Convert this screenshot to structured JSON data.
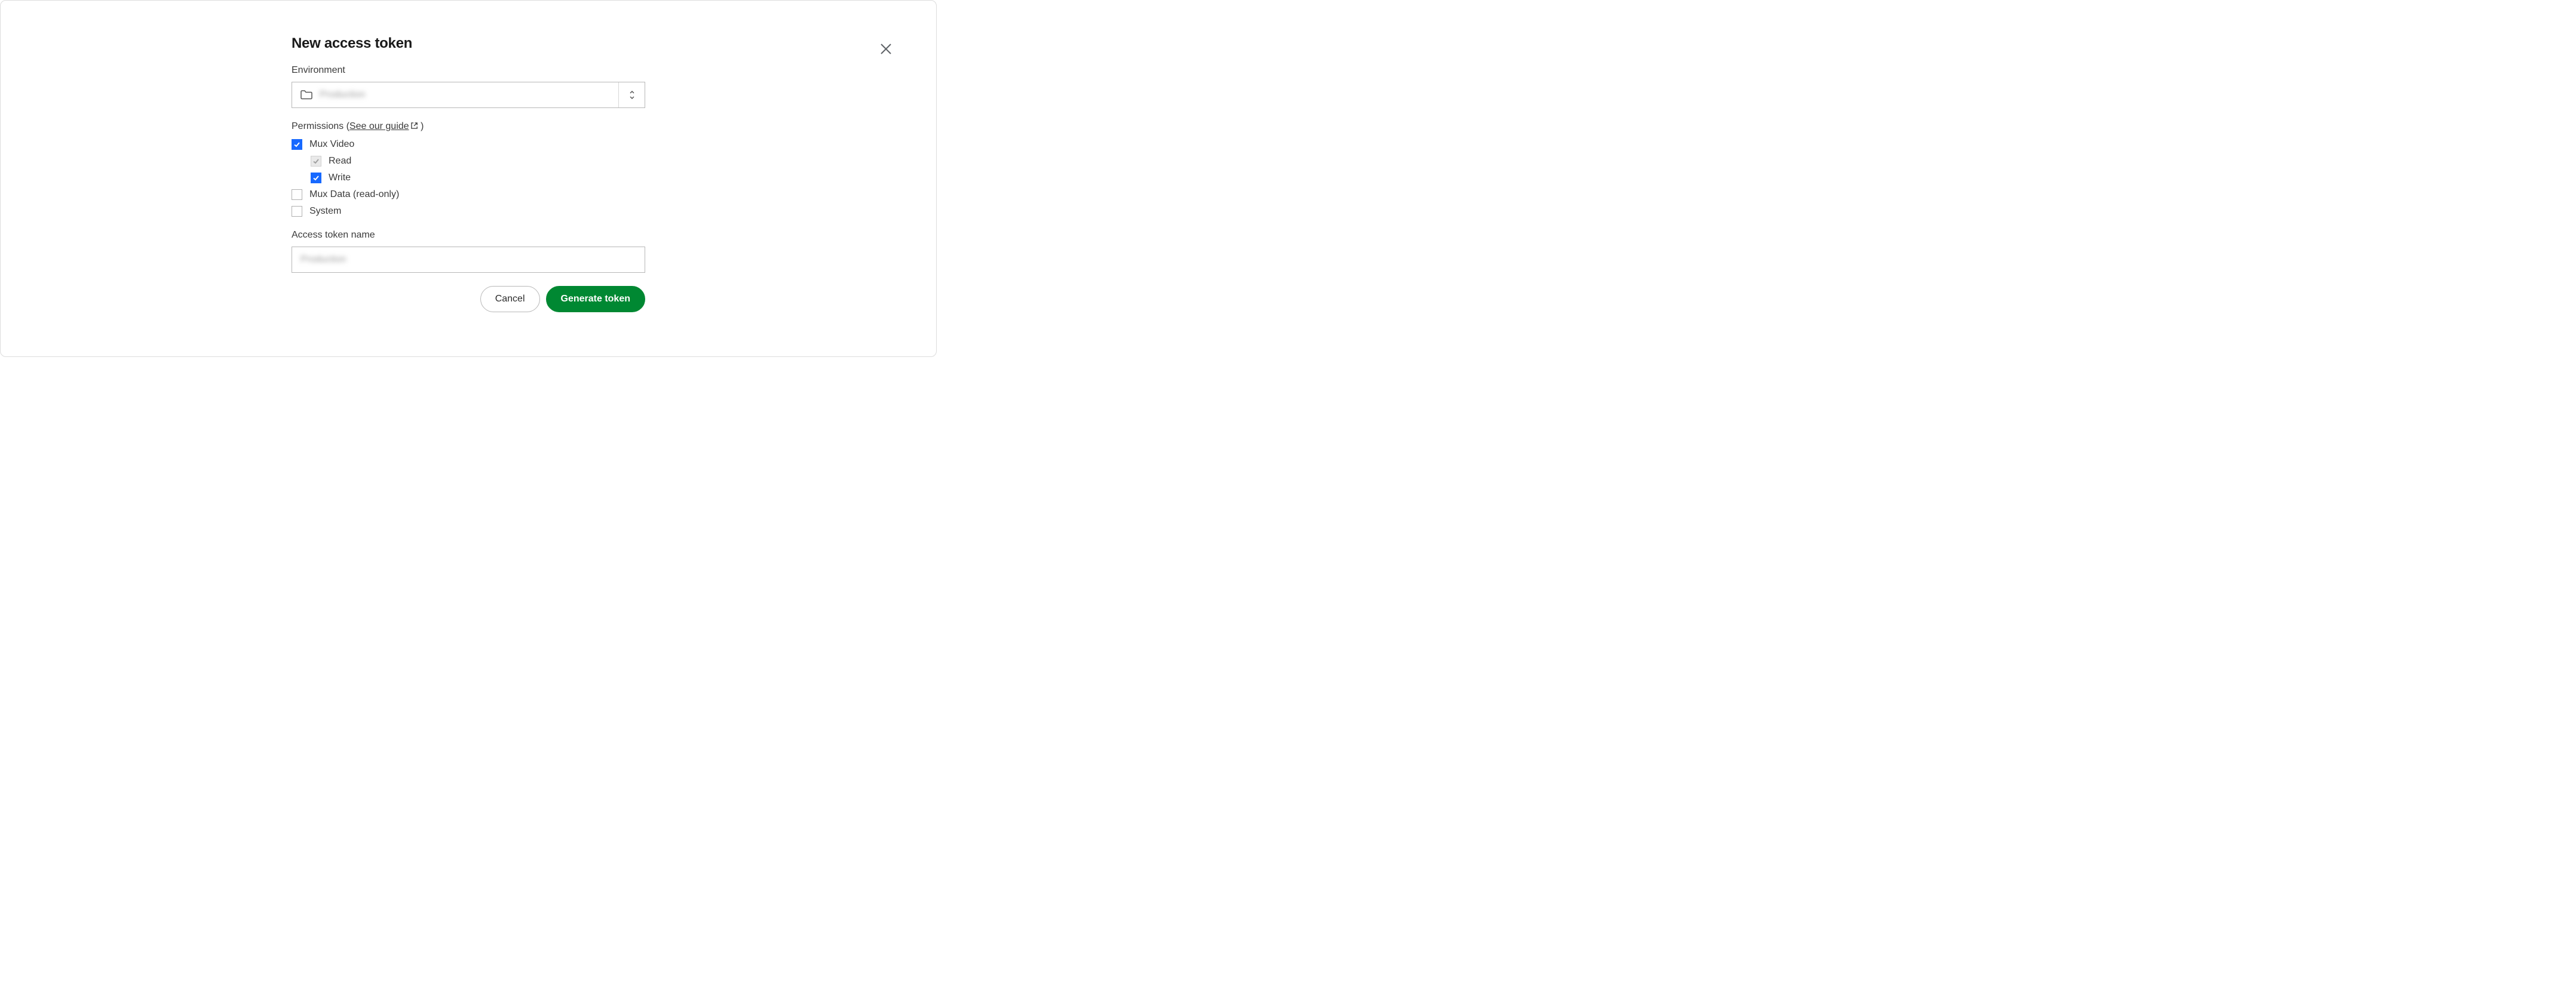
{
  "dialog": {
    "title": "New access token",
    "environment": {
      "label": "Environment",
      "value": "Production"
    },
    "permissions": {
      "label_prefix": "Permissions (",
      "guide_text": "See our guide",
      "label_suffix": " )",
      "items": [
        {
          "label": "Mux Video",
          "checked": true,
          "children": [
            {
              "label": "Read",
              "checked": true,
              "disabled": true
            },
            {
              "label": "Write",
              "checked": true
            }
          ]
        },
        {
          "label": "Mux Data (read-only)",
          "checked": false
        },
        {
          "label": "System",
          "checked": false
        }
      ]
    },
    "token_name": {
      "label": "Access token name",
      "value": "Production"
    },
    "actions": {
      "cancel": "Cancel",
      "submit": "Generate token"
    }
  }
}
